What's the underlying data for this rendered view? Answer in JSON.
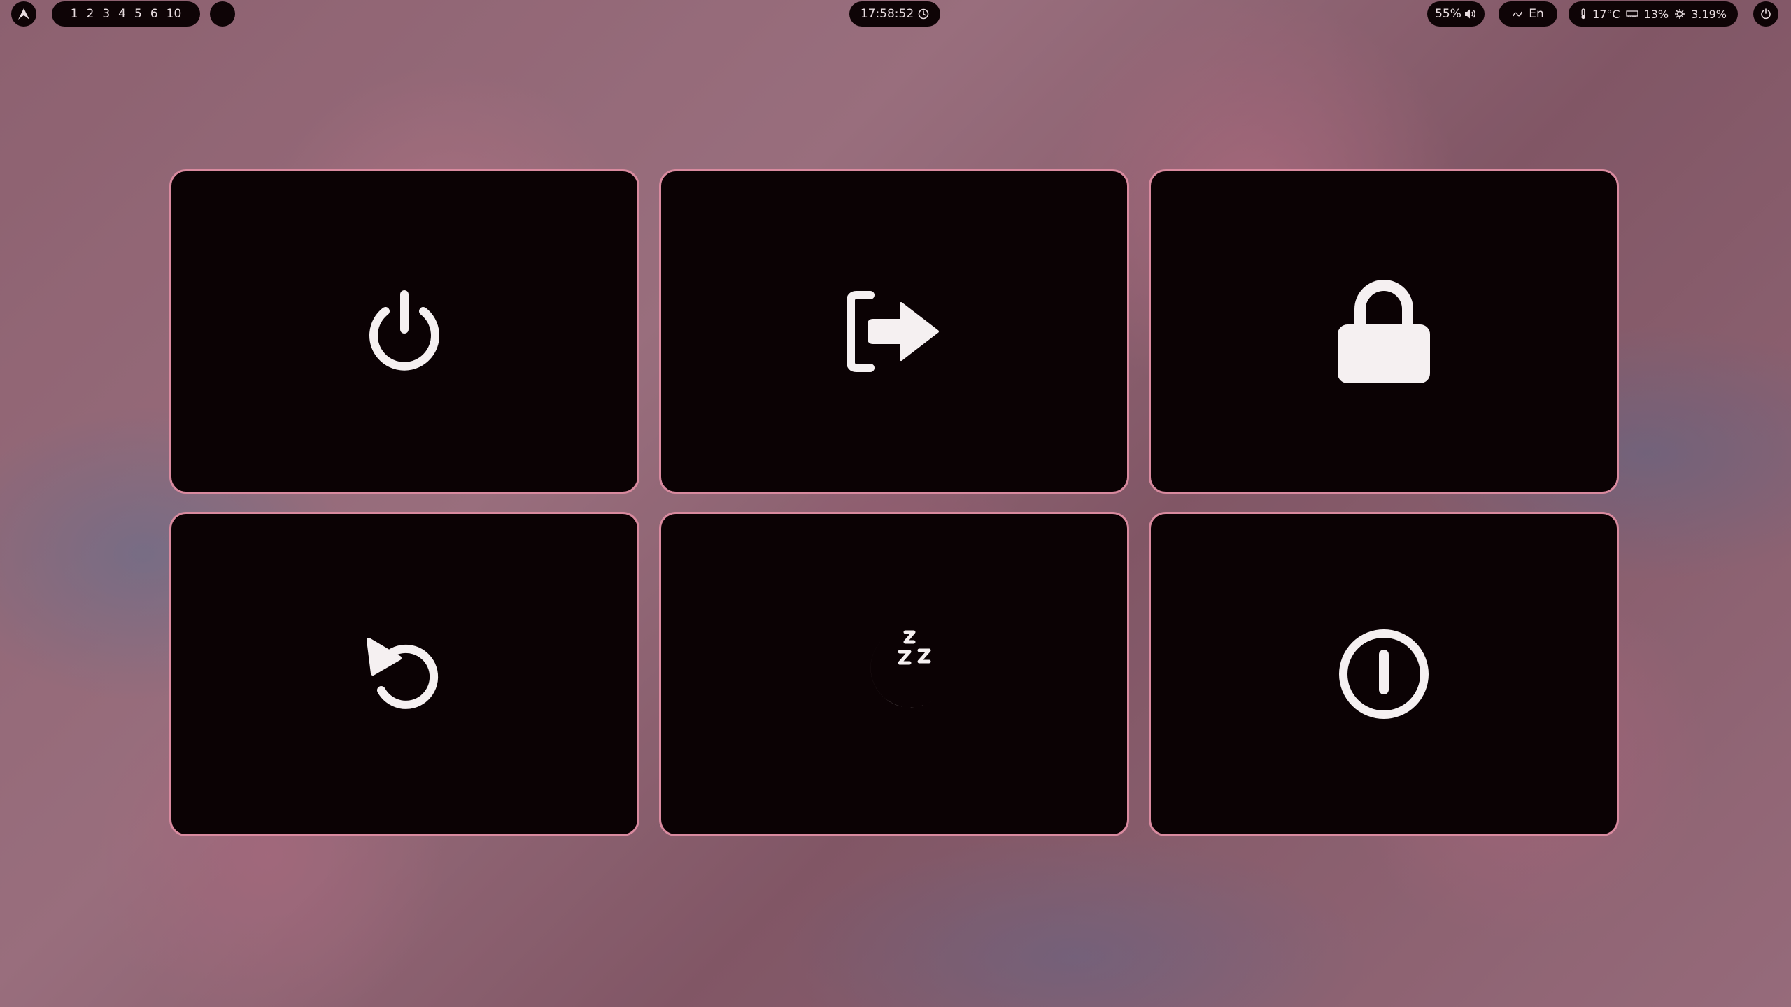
{
  "colors": {
    "bar_bg": "#0e0406",
    "tile_bg": "#0b0204",
    "tile_border": "#d98a9f",
    "icon": "#f5f0f1",
    "text": "#e8dde0"
  },
  "topbar": {
    "launcher": {
      "icon": "arch-logo-icon"
    },
    "workspaces": [
      "1",
      "2",
      "3",
      "4",
      "5",
      "6",
      "10"
    ],
    "workspace_indicator": {
      "icon": "circle-icon"
    },
    "clock": {
      "time": "17:58:52",
      "icon": "clock-icon"
    },
    "volume": {
      "value": "55%",
      "icon": "speaker-icon"
    },
    "keyboard": {
      "layout": "En",
      "icon": "keyboard-icon"
    },
    "stats": {
      "temperature": "17°C",
      "temperature_icon": "thermometer-icon",
      "memory": "13%",
      "memory_icon": "memory-icon",
      "cpu": "3.19%",
      "cpu_icon": "cpu-icon"
    },
    "power": {
      "icon": "power-icon"
    }
  },
  "menu": {
    "tiles": [
      {
        "action": "shutdown",
        "icon": "power-icon"
      },
      {
        "action": "logout",
        "icon": "logout-icon"
      },
      {
        "action": "lock",
        "icon": "lock-icon"
      },
      {
        "action": "reboot",
        "icon": "reboot-icon"
      },
      {
        "action": "suspend",
        "icon": "sleep-moon-icon"
      },
      {
        "action": "hibernate",
        "icon": "hibernate-icon"
      }
    ]
  }
}
